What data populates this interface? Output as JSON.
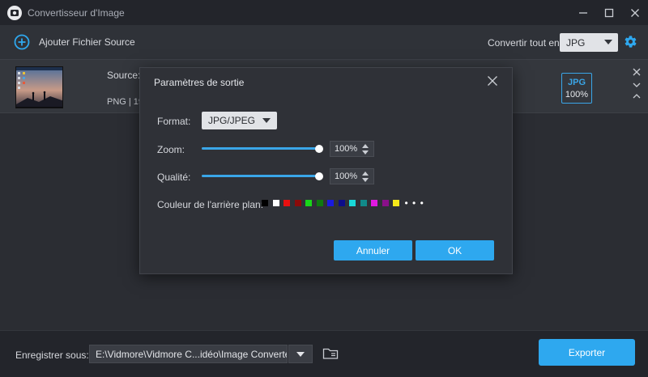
{
  "window": {
    "title": "Convertisseur d'Image",
    "icons": [
      "app-logo-icon",
      "minimize-icon",
      "maximize-icon",
      "close-icon"
    ]
  },
  "toolbar": {
    "add_label": "Ajouter Fichier Source",
    "convert_label": "Convertir tout en:",
    "convert_value": "JPG",
    "icons": [
      "plus-circle-icon",
      "chevron-down-icon",
      "gear-icon"
    ]
  },
  "file": {
    "source_label": "Source:",
    "meta": "PNG | 19",
    "output_format": "JPG",
    "output_quality": "100%",
    "icons": [
      "close-icon",
      "chevron-down-icon",
      "chevron-up-icon"
    ]
  },
  "dialog": {
    "title": "Paramètres de sortie",
    "format_label": "Format:",
    "format_value": "JPG/JPEG",
    "zoom_label": "Zoom:",
    "zoom_value": "100%",
    "zoom_level": 1.0,
    "quality_label": "Qualité:",
    "quality_value": "100%",
    "quality_level": 1.0,
    "bg_label": "Couleur de l'arrière plan:",
    "bg_colors": [
      "#000000",
      "#ffffff",
      "#e81010",
      "#8b0a0a",
      "#19d719",
      "#0f7a0f",
      "#1a1adf",
      "#0d0d8a",
      "#19d8d8",
      "#118a8a",
      "#e019e0",
      "#8a108a",
      "#f5e81a"
    ],
    "more": "• • •",
    "cancel_label": "Annuler",
    "ok_label": "OK"
  },
  "bottom": {
    "save_label": "Enregistrer sous:",
    "path": "E:\\Vidmore\\Vidmore C...idéo\\Image Converter",
    "export_label": "Exporter",
    "icons": [
      "chevron-down-icon",
      "folder-icon"
    ]
  },
  "colors": {
    "accent": "#2ea8ef",
    "background": "#2b2d33",
    "titlebar": "#23252b",
    "dialog": "#2f3137"
  }
}
